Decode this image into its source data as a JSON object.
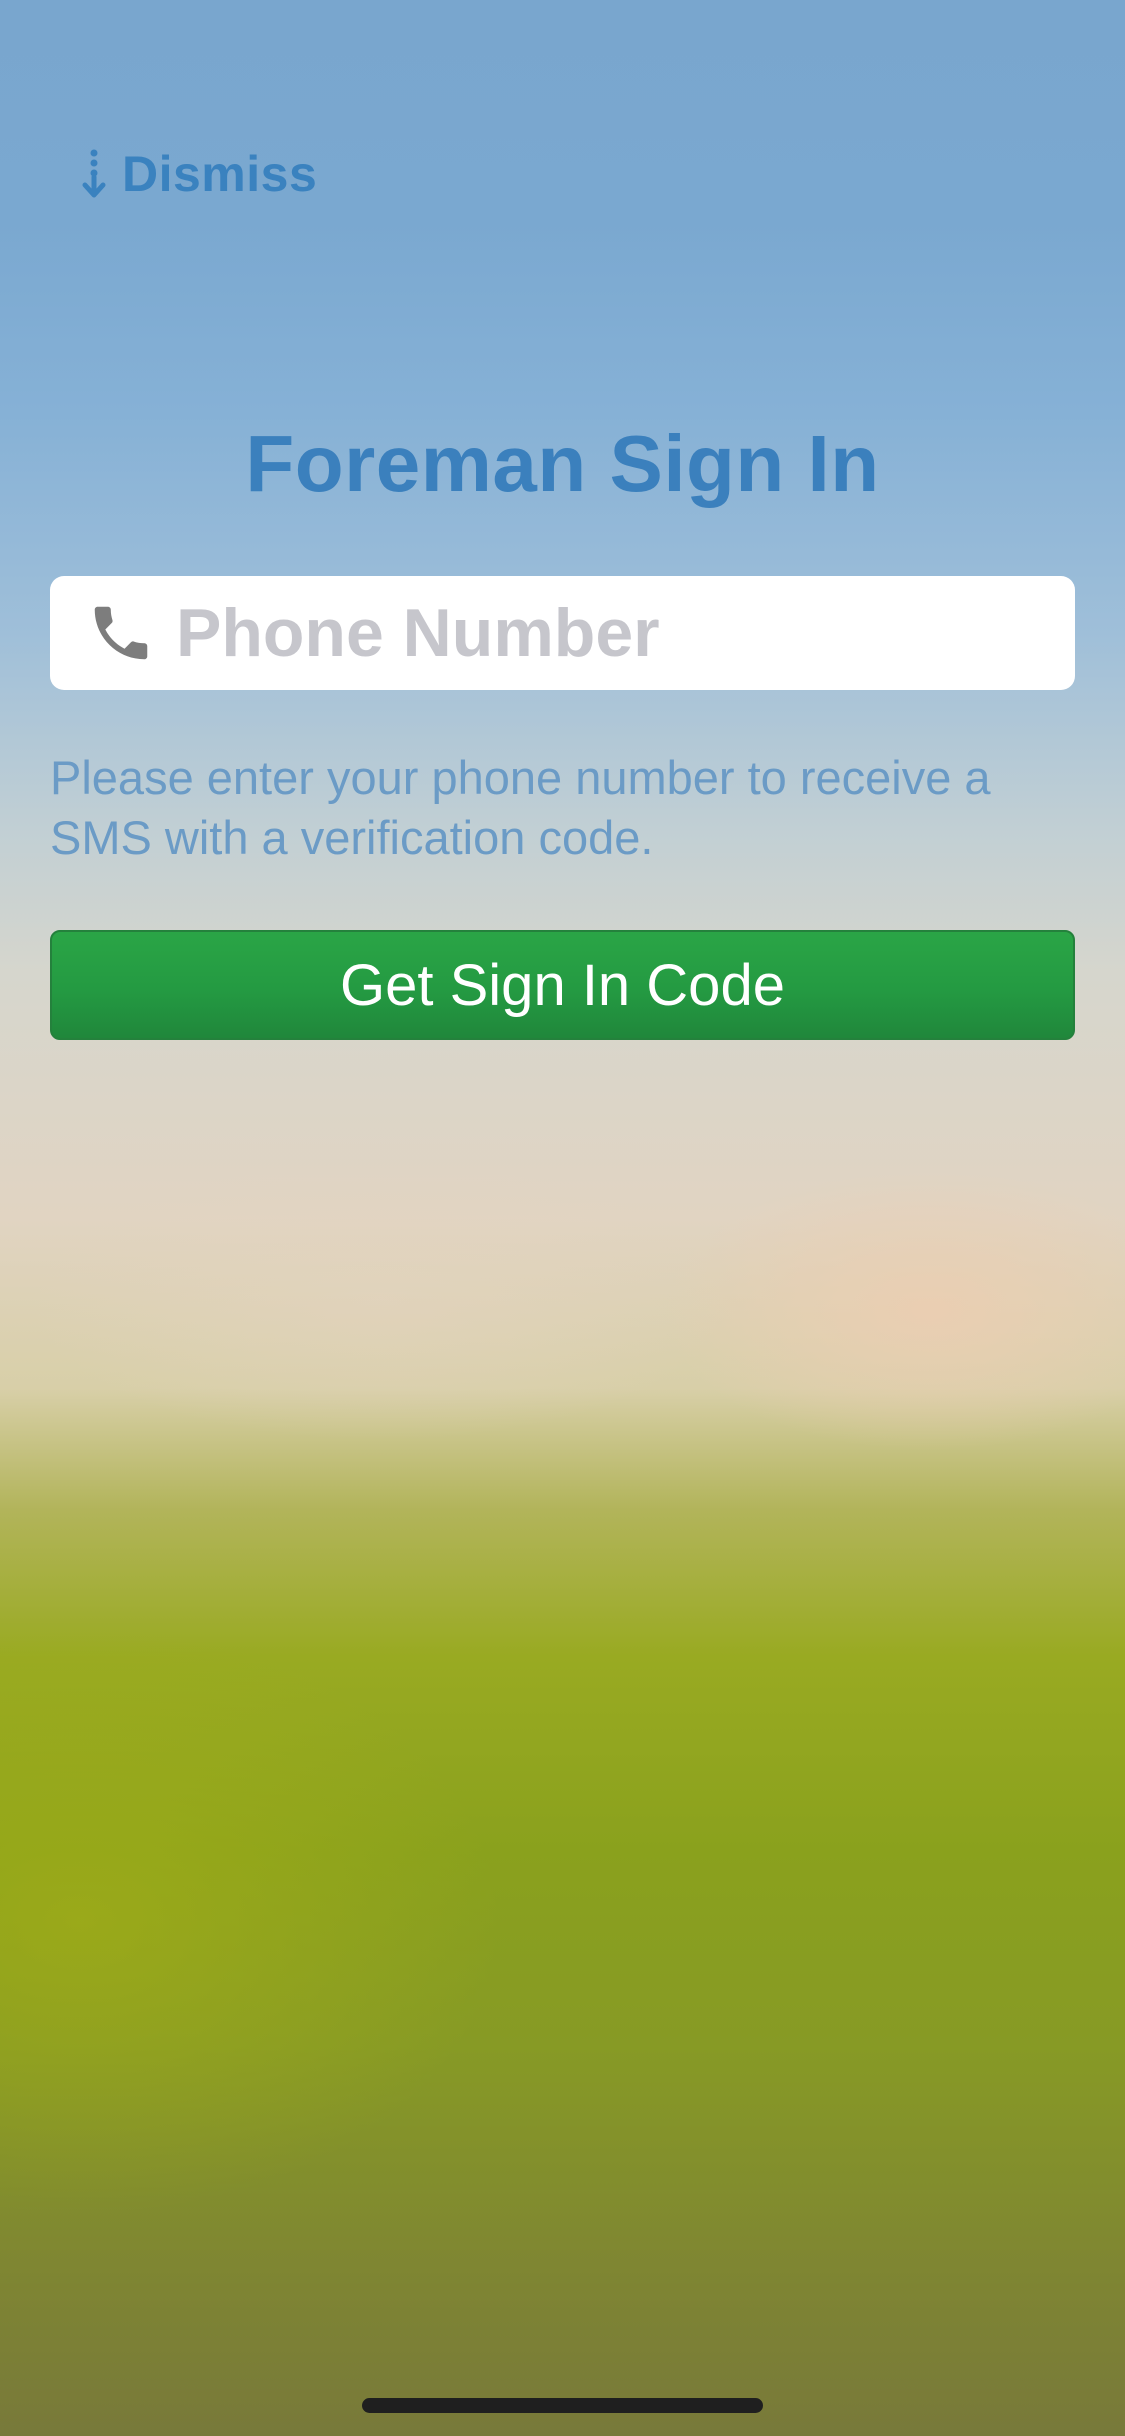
{
  "header": {
    "dismiss_label": "Dismiss",
    "dismiss_icon": "dotted-arrow-down-icon"
  },
  "signin": {
    "title": "Foreman Sign In",
    "phone_placeholder": "Phone Number",
    "phone_value": "",
    "phone_icon": "phone-icon",
    "help_text": "Please enter your phone number to receive a SMS with a verification code.",
    "submit_label": "Get Sign In Code"
  },
  "colors": {
    "accent": "#3b80bd",
    "button": "#249a42",
    "placeholder": "#c6c6cc"
  }
}
